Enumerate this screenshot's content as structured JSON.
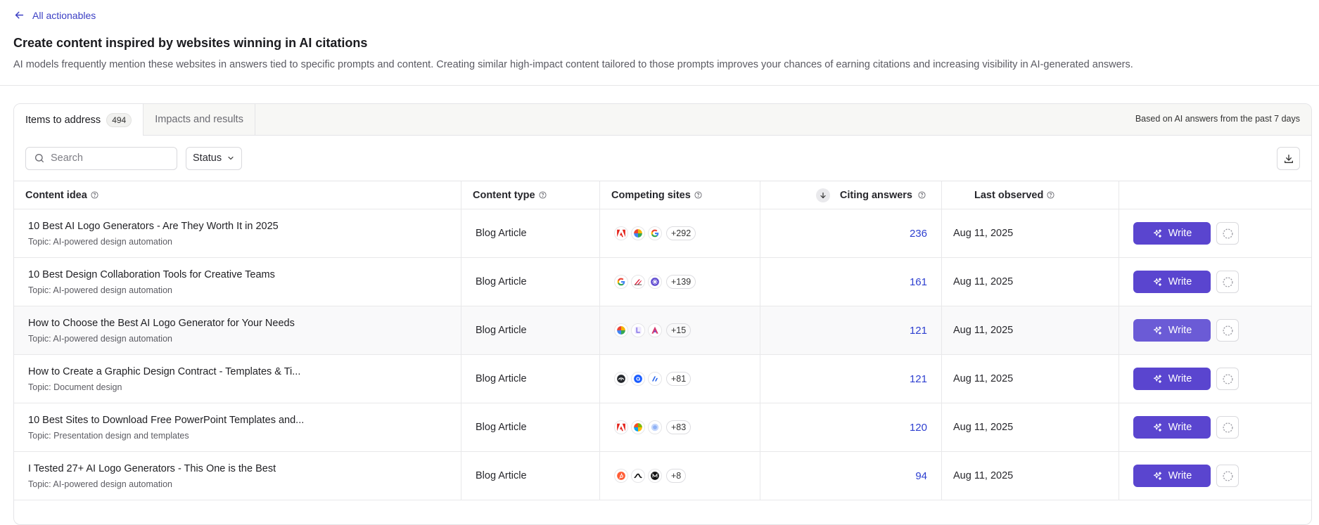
{
  "nav": {
    "back_label": "All actionables"
  },
  "page": {
    "title": "Create content inspired by websites winning in AI citations",
    "description": "AI models frequently mention these websites in answers tied to specific prompts and content. Creating similar high-impact content tailored to those prompts improves your chances of earning citations and increasing visibility in AI-generated answers."
  },
  "tabs": [
    {
      "label": "Items to address",
      "count": "494"
    },
    {
      "label": "Impacts and results"
    }
  ],
  "tabs_note": "Based on AI answers from the past 7 days",
  "toolbar": {
    "search_placeholder": "Search",
    "status_label": "Status"
  },
  "columns": {
    "content_idea": "Content idea",
    "content_type": "Content type",
    "competing_sites": "Competing sites",
    "citing_answers": "Citing answers",
    "last_observed": "Last observed"
  },
  "write_label": "Write",
  "rows": [
    {
      "title": "10 Best AI Logo Generators - Are They Worth It in 2025",
      "topic": "Topic: AI-powered design automation",
      "type": "Blog Article",
      "more": "+292",
      "cites": "236",
      "observed": "Aug 11, 2025",
      "icons": [
        "adobe-icon",
        "color-wheel-icon",
        "google-icon"
      ]
    },
    {
      "title": "10 Best Design Collaboration Tools for Creative Teams",
      "topic": "Topic: AI-powered design automation",
      "type": "Blog Article",
      "more": "+139",
      "cites": "161",
      "observed": "Aug 11, 2025",
      "icons": [
        "google-icon",
        "slash-logo-icon",
        "starburst-icon"
      ]
    },
    {
      "title": "How to Choose the Best AI Logo Generator for Your Needs",
      "topic": "Topic: AI-powered design automation",
      "type": "Blog Article",
      "more": "+15",
      "cites": "121",
      "observed": "Aug 11, 2025",
      "icons": [
        "color-wheel-icon",
        "l-logo-icon",
        "a-logo-icon"
      ]
    },
    {
      "title": "How to Create a Graphic Design Contract - Templates & Ti...",
      "topic": "Topic: Document design",
      "type": "Blog Article",
      "more": "+81",
      "cites": "121",
      "observed": "Aug 11, 2025",
      "icons": [
        "dark-logo-icon",
        "blue-a-icon",
        "stripes-logo-icon"
      ]
    },
    {
      "title": "10 Best Sites to Download Free PowerPoint Templates and...",
      "topic": "Topic: Presentation design and templates",
      "type": "Blog Article",
      "more": "+83",
      "cites": "120",
      "observed": "Aug 11, 2025",
      "icons": [
        "adobe-icon",
        "microsoft-icon",
        "blue-circle-icon"
      ]
    },
    {
      "title": "I Tested 27+ AI Logo Generators - This One is the Best",
      "topic": "Topic: AI-powered design automation",
      "type": "Blog Article",
      "more": "+8",
      "cites": "94",
      "observed": "Aug 11, 2025",
      "icons": [
        "hubspot-icon",
        "black-swirl-icon",
        "medium-icon"
      ]
    }
  ],
  "colors": {
    "accent": "#5a45cf",
    "link": "#2d3fd0"
  }
}
